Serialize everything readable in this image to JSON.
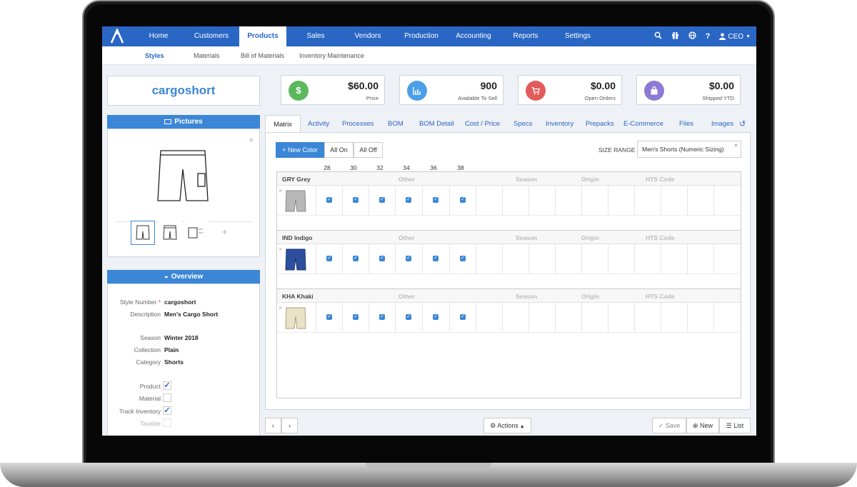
{
  "nav": {
    "items": [
      "Home",
      "Customers",
      "Products",
      "Sales",
      "Vendors",
      "Production",
      "Accounting",
      "Reports",
      "Settings"
    ],
    "active": "Products",
    "user": "CEO"
  },
  "subnav": {
    "items": [
      "Styles",
      "Materials",
      "Bill of Materials",
      "Inventory Maintenance"
    ],
    "active": "Styles"
  },
  "style_name": "cargoshort",
  "cards": [
    {
      "value": "$60.00",
      "label": "Price",
      "icon": "dollar-icon",
      "color": "#5cb85c"
    },
    {
      "value": "900",
      "label": "Available To Sell",
      "icon": "chart-icon",
      "color": "#4a9fe8"
    },
    {
      "value": "$0.00",
      "label": "Open Orders",
      "icon": "cart-icon",
      "color": "#e25b5b"
    },
    {
      "value": "$0.00",
      "label": "Shipped YTD",
      "icon": "bag-icon",
      "color": "#8c7bd4"
    }
  ],
  "pictures": {
    "title": "Pictures"
  },
  "overview": {
    "title": "Overview",
    "fields": [
      {
        "label": "Style Number",
        "value": "cargoshort",
        "required": true
      },
      {
        "label": "Description",
        "value": "Men's Cargo Short"
      },
      {
        "label": "Season",
        "value": "Winter 2018"
      },
      {
        "label": "Collection",
        "value": "Plain"
      },
      {
        "label": "Category",
        "value": "Shorts"
      }
    ],
    "flags": [
      {
        "label": "Product",
        "checked": true
      },
      {
        "label": "Material",
        "checked": false
      },
      {
        "label": "Track Inventory",
        "checked": true
      },
      {
        "label": "Taxable",
        "checked": false
      }
    ]
  },
  "tabs": [
    "Matrix",
    "Activity",
    "Processes",
    "BOM",
    "BOM Detail",
    "Cost / Price",
    "Specs",
    "Inventory",
    "Prepacks",
    "E-Commerce",
    "Files",
    "Images"
  ],
  "active_tab": "Matrix",
  "matrix": {
    "new_color": "New Color",
    "all_on": "All On",
    "all_off": "All Off",
    "size_range_label": "SIZE RANGE",
    "size_range_value": "Men's Shorts (Numeric Sizing)",
    "sizes": [
      "28",
      "30",
      "32",
      "34",
      "36",
      "38"
    ],
    "column_labels": [
      "Other",
      "Season",
      "Origin",
      "HTS Code"
    ],
    "colors": [
      {
        "name": "GRY Grey",
        "swatch": "#b8b8b8"
      },
      {
        "name": "IND Indigo",
        "swatch": "#2d4f9e"
      },
      {
        "name": "KHA Khaki",
        "swatch": "#ebe3c8"
      }
    ]
  },
  "bottom": {
    "actions": "Actions",
    "save": "Save",
    "new": "New",
    "list": "List"
  }
}
